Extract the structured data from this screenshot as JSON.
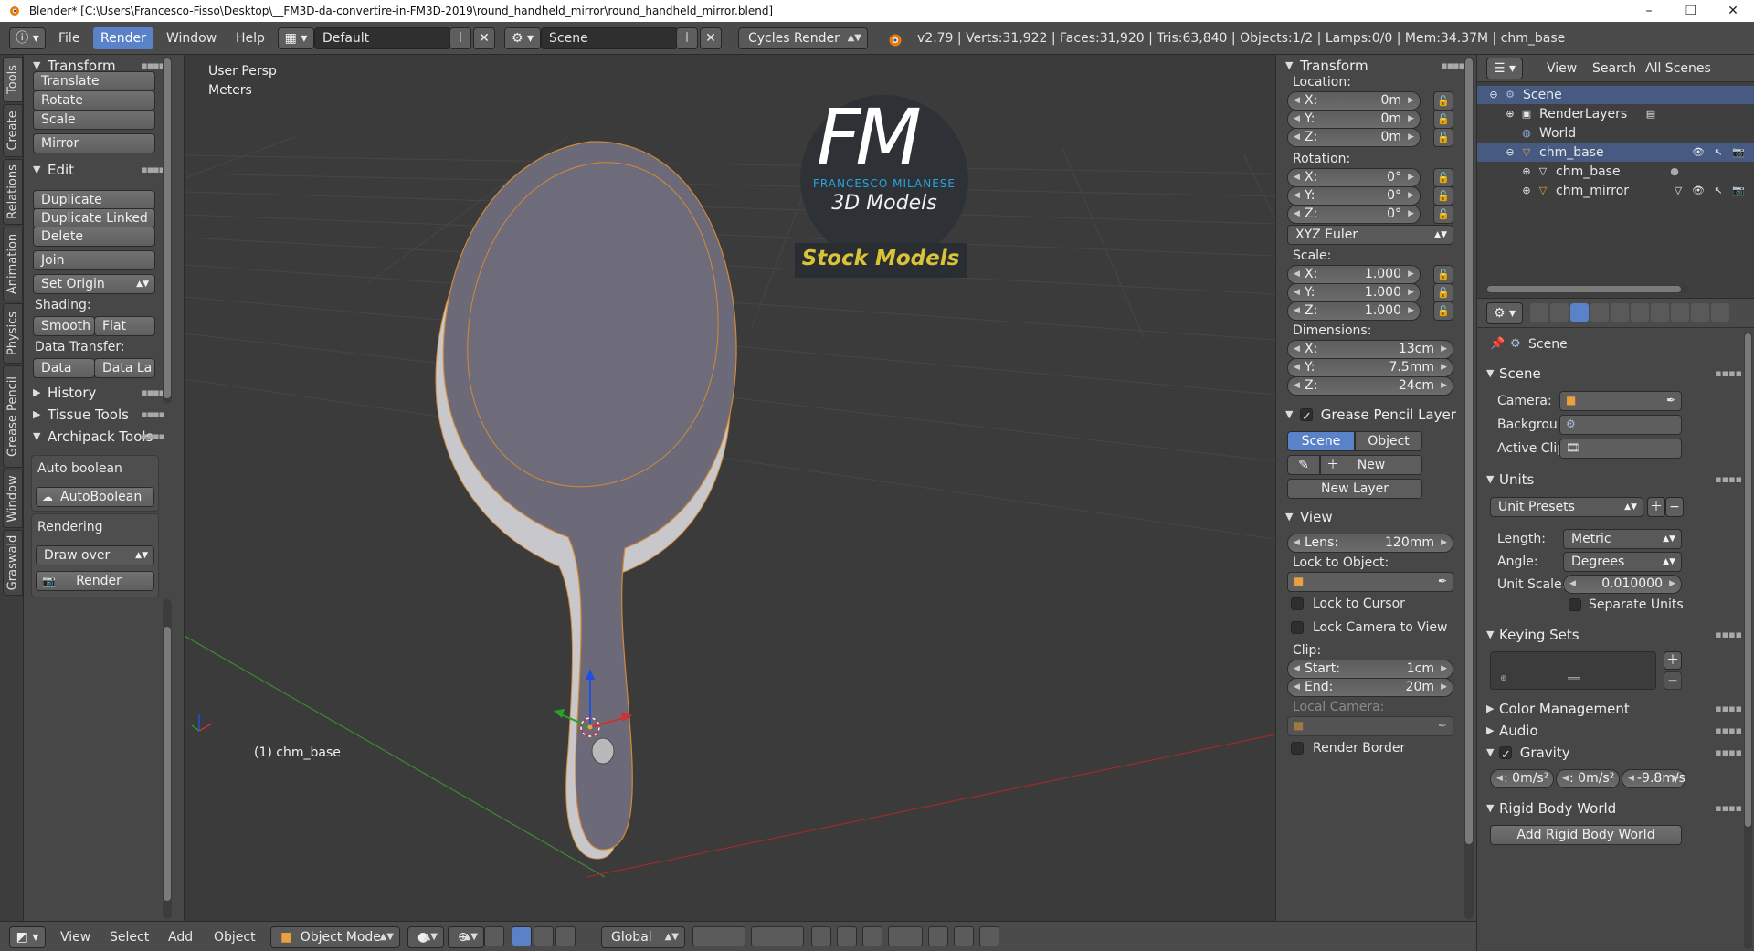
{
  "window": {
    "title": "Blender* [C:\\Users\\Francesco-Fisso\\Desktop\\__FM3D-da-convertire-in-FM3D-2019\\round_handheld_mirror\\round_handheld_mirror.blend]",
    "minimize": "–",
    "maximize": "❐",
    "close": "✕"
  },
  "infobar": {
    "menus": [
      "File",
      "Render",
      "Window",
      "Help"
    ],
    "active_menu": "Render",
    "layout": "Default",
    "scene": "Scene",
    "engine": "Cycles Render",
    "stats": "v2.79 | Verts:31,922 | Faces:31,920 | Tris:63,840 | Objects:1/2 | Lamps:0/0 | Mem:34.37M | chm_base"
  },
  "vtabs": [
    "Tools",
    "Create",
    "Relations",
    "Animation",
    "Physics",
    "Grease Pencil",
    "Window",
    "Graswald"
  ],
  "toolshelf": {
    "transform_title": "Transform",
    "translate": "Translate",
    "rotate": "Rotate",
    "scale": "Scale",
    "mirror": "Mirror",
    "edit_title": "Edit",
    "duplicate": "Duplicate",
    "duplicate_linked": "Duplicate Linked",
    "delete": "Delete",
    "join": "Join",
    "set_origin": "Set Origin",
    "shading_label": "Shading:",
    "smooth": "Smooth",
    "flat": "Flat",
    "data_transfer_label": "Data Transfer:",
    "data": "Data",
    "data_la": "Data La",
    "history": "History",
    "tissue_tools": "Tissue Tools",
    "archipack_tools": "Archipack Tools",
    "auto_boolean_label": "Auto boolean",
    "autoboolean_btn": "AutoBoolean",
    "rendering_label": "Rendering",
    "draw_over": "Draw over",
    "render_btn": "Render"
  },
  "viewport": {
    "view_name": "User Persp",
    "units": "Meters",
    "object_label": "(1) chm_base",
    "logo_letters": "FM",
    "logo_name": "FRANCESCO MILANESE",
    "logo_sub": "3D Models",
    "banner": "Stock Models"
  },
  "npanel": {
    "transform_title": "Transform",
    "location_label": "Location:",
    "location": [
      {
        "axis": "X:",
        "value": "0m"
      },
      {
        "axis": "Y:",
        "value": "0m"
      },
      {
        "axis": "Z:",
        "value": "0m"
      }
    ],
    "rotation_label": "Rotation:",
    "rotation": [
      {
        "axis": "X:",
        "value": "0°"
      },
      {
        "axis": "Y:",
        "value": "0°"
      },
      {
        "axis": "Z:",
        "value": "0°"
      }
    ],
    "rotation_mode": "XYZ Euler",
    "scale_label": "Scale:",
    "scale": [
      {
        "axis": "X:",
        "value": "1.000"
      },
      {
        "axis": "Y:",
        "value": "1.000"
      },
      {
        "axis": "Z:",
        "value": "1.000"
      }
    ],
    "dimensions_label": "Dimensions:",
    "dimensions": [
      {
        "axis": "X:",
        "value": "13cm"
      },
      {
        "axis": "Y:",
        "value": "7.5mm"
      },
      {
        "axis": "Z:",
        "value": "24cm"
      }
    ],
    "grease_pencil_title": "Grease Pencil Layer",
    "gp_scene": "Scene",
    "gp_object": "Object",
    "gp_new": "New",
    "gp_new_layer": "New Layer",
    "view_title": "View",
    "lens_label": "Lens:",
    "lens_value": "120mm",
    "lock_to_object": "Lock to Object:",
    "lock_to_cursor": "Lock to Cursor",
    "lock_camera": "Lock Camera to View",
    "clip_label": "Clip:",
    "clip_start_label": "Start:",
    "clip_start": "1cm",
    "clip_end_label": "End:",
    "clip_end": "20m",
    "local_camera": "Local Camera:",
    "render_border": "Render Border"
  },
  "outliner": {
    "view": "View",
    "search": "Search",
    "filter": "All Scenes",
    "rows": [
      {
        "label": "Scene",
        "indent": 0
      },
      {
        "label": "RenderLayers",
        "indent": 1
      },
      {
        "label": "World",
        "indent": 1
      },
      {
        "label": "chm_base",
        "indent": 1
      },
      {
        "label": "chm_base",
        "indent": 2
      },
      {
        "label": "chm_mirror",
        "indent": 2
      }
    ]
  },
  "props": {
    "context": "Scene",
    "scene_title": "Scene",
    "camera_label": "Camera:",
    "background_label": "Backgrou...",
    "active_clip_label": "Active Clip:",
    "units_title": "Units",
    "unit_presets": "Unit Presets",
    "length_label": "Length:",
    "length": "Metric",
    "angle_label": "Angle:",
    "angle": "Degrees",
    "unit_scale_label": "Unit Scale:",
    "unit_scale": "0.010000",
    "separate_units": "Separate Units",
    "keying_sets_title": "Keying Sets",
    "color_management": "Color Management",
    "audio": "Audio",
    "gravity_title": "Gravity",
    "gravity": [
      ": 0m/s²",
      ": 0m/s²",
      "-9.8m/s"
    ],
    "rigid_body_world": "Rigid Body World",
    "add_rigid_body_world": "Add Rigid Body World"
  },
  "bottombar": {
    "view": "View",
    "select": "Select",
    "add": "Add",
    "object": "Object",
    "mode": "Object Mode",
    "orientation": "Global"
  }
}
